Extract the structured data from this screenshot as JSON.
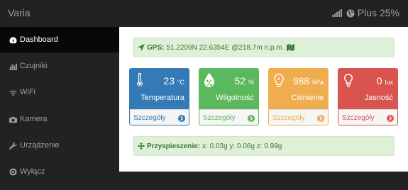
{
  "header": {
    "brand": "Varia",
    "network_label": "Plus",
    "battery": "25%"
  },
  "sidebar": {
    "items": [
      {
        "label": "Dashboard",
        "icon": "tachometer-icon",
        "active": true
      },
      {
        "label": "Czujniki",
        "icon": "bar-chart-icon",
        "active": false
      },
      {
        "label": "WiFi",
        "icon": "wifi-icon",
        "active": false
      },
      {
        "label": "Kamera",
        "icon": "camera-icon",
        "active": false
      },
      {
        "label": "Urządzenie",
        "icon": "wrench-icon",
        "active": false
      },
      {
        "label": "Wyłącz",
        "icon": "power-icon",
        "active": false
      }
    ]
  },
  "gps": {
    "label": "GPS:",
    "value": "51.2209N 22.6354E @218.7m n.p.m."
  },
  "accel": {
    "label": "Przyspieszenie:",
    "value": "x: 0.03g y: 0.06g z: 0.99g"
  },
  "panels": [
    {
      "value": "23",
      "unit": "°C",
      "label": "Temperatura",
      "link": "Szczegóły",
      "color": "#337ab7",
      "icon": "thermometer-icon"
    },
    {
      "value": "52",
      "unit": "%",
      "label": "Wilgotność",
      "link": "Szczegóły",
      "color": "#5cb85c",
      "icon": "percent-icon"
    },
    {
      "value": "988",
      "unit": "hPa",
      "label": "Ciśnienie",
      "link": "Szczegóły",
      "color": "#f0ad4e",
      "icon": "gauge-icon"
    },
    {
      "value": "0",
      "unit": "lux",
      "label": "Jasność",
      "link": "Szczegóły",
      "color": "#d9534f",
      "icon": "lightbulb-icon"
    }
  ]
}
